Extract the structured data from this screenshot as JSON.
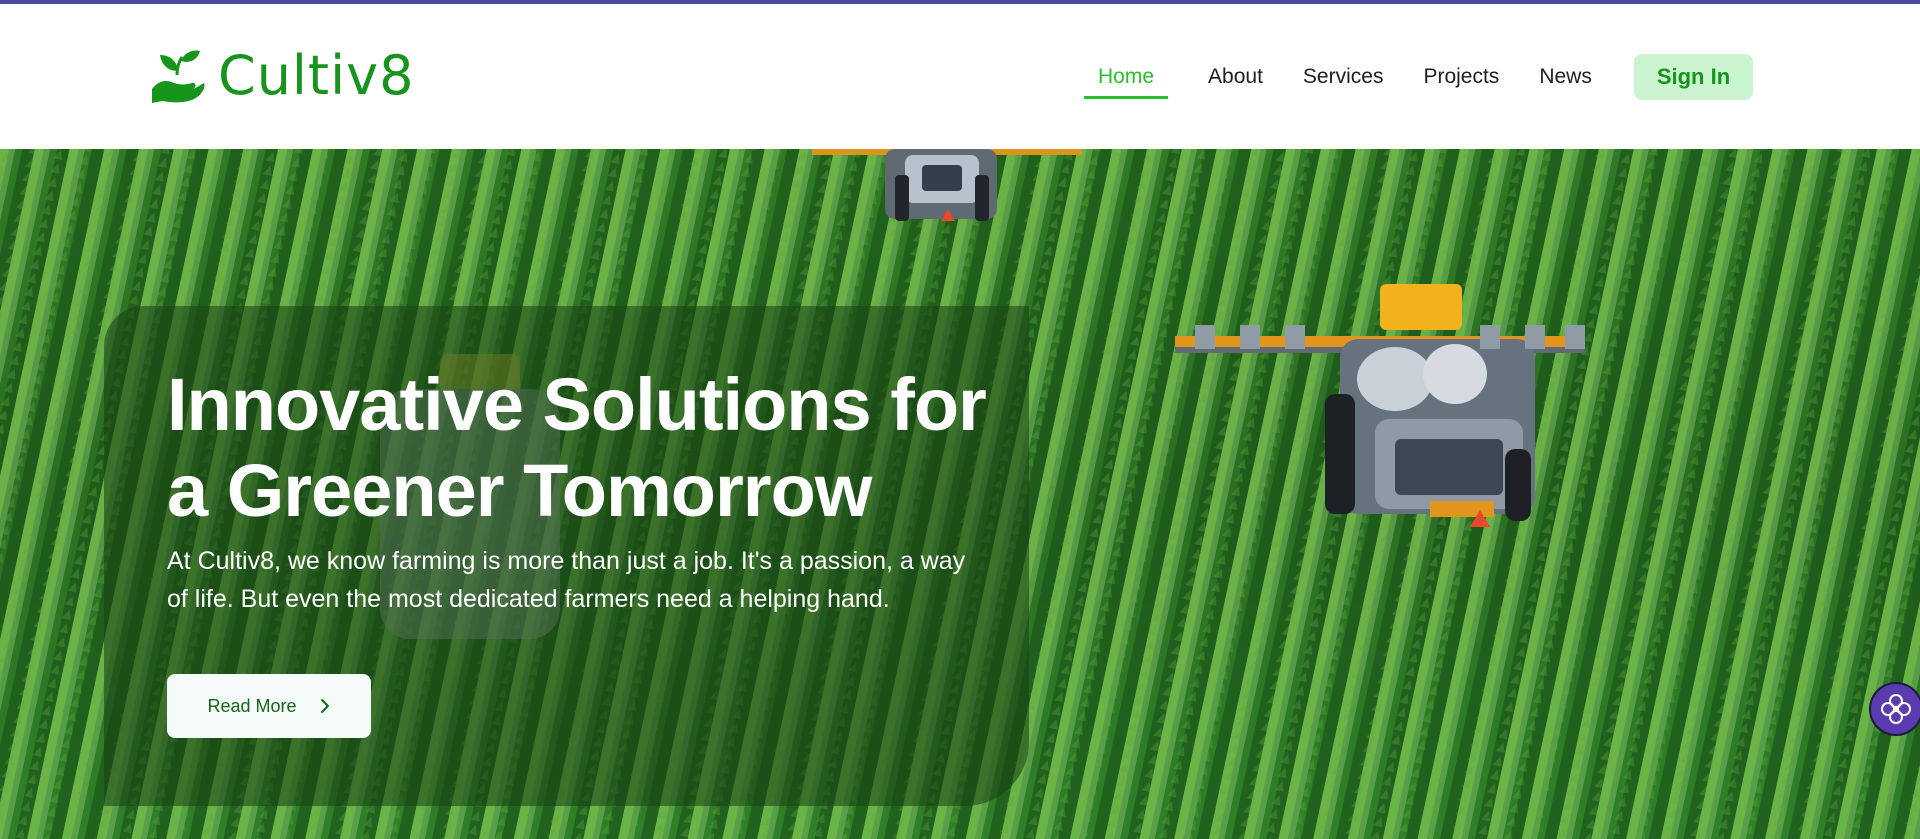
{
  "brand": {
    "name": "Cultiv8",
    "icon": "hand-sprout-icon",
    "color": "#17941b"
  },
  "nav": {
    "items": [
      {
        "label": "Home",
        "active": true
      },
      {
        "label": "About",
        "active": false
      },
      {
        "label": "Services",
        "active": false
      },
      {
        "label": "Projects",
        "active": false
      },
      {
        "label": "News",
        "active": false
      }
    ],
    "sign_in": "Sign In",
    "active_color": "#28c22a"
  },
  "hero": {
    "title": "Innovative Solutions for a Greener Tomorrow",
    "text": "At Cultiv8, we know farming is more than just a job. It's a passion, a way of life. But even the most dedicated farmers need a helping hand.",
    "button_label": "Read More",
    "button_icon": "chevron-right-icon",
    "background": "aerial-cornfield-tractors-photo"
  },
  "assistant": {
    "icon": "flower-assistant-icon"
  },
  "colors": {
    "top_accent": "#4b4b9a",
    "sign_in_bg": "#c9f4cf"
  }
}
